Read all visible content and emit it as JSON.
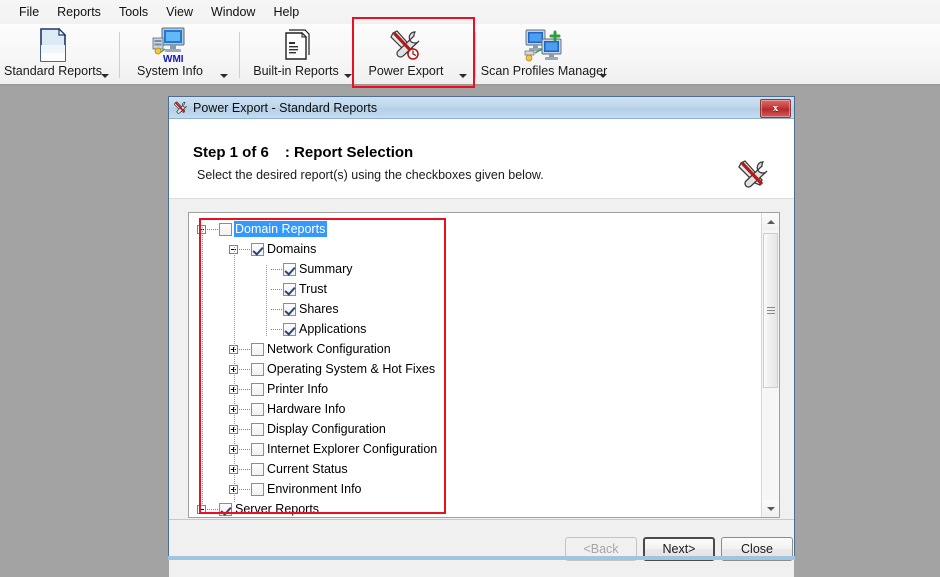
{
  "menubar": {
    "items": [
      {
        "label": "File"
      },
      {
        "label": "Reports"
      },
      {
        "label": "Tools"
      },
      {
        "label": "View"
      },
      {
        "label": "Window"
      },
      {
        "label": "Help"
      }
    ]
  },
  "toolbar": {
    "items": [
      {
        "label": "Standard Reports",
        "icon": "document-icon",
        "has_dropdown": true
      },
      {
        "label": "System Info",
        "icon": "wmi-monitor-icon",
        "has_dropdown": true
      },
      {
        "label": "Built-in Reports",
        "icon": "clipboard-icon",
        "has_dropdown": true
      },
      {
        "label": "Power Export",
        "icon": "tools-icon",
        "has_dropdown": true,
        "highlighted": true
      },
      {
        "label": "Scan Profiles Manager",
        "icon": "computers-icon",
        "has_dropdown": true
      }
    ],
    "highlight_color": "#e81123"
  },
  "dialog": {
    "title": "Power Export - Standard Reports",
    "title_icon": "tools-icon",
    "close_label": "x",
    "step_label": "Step 1 of 6",
    "step_title": ": Report Selection",
    "instruction": "Select the desired report(s) using the checkboxes given below.",
    "header_icon": "tools-icon",
    "selection_color": "#3399ff",
    "highlight_color": "#e81123",
    "tree": [
      {
        "label": "Domain Reports",
        "level": 0,
        "expander": "minus",
        "checked": false,
        "selected": true
      },
      {
        "label": "Domains",
        "level": 1,
        "expander": "minus",
        "checked": true,
        "selected": false
      },
      {
        "label": "Summary",
        "level": 2,
        "expander": "none",
        "checked": true,
        "selected": false
      },
      {
        "label": "Trust",
        "level": 2,
        "expander": "none",
        "checked": true,
        "selected": false
      },
      {
        "label": "Shares",
        "level": 2,
        "expander": "none",
        "checked": true,
        "selected": false
      },
      {
        "label": "Applications",
        "level": 2,
        "expander": "none",
        "checked": true,
        "selected": false
      },
      {
        "label": "Network Configuration",
        "level": 1,
        "expander": "plus",
        "checked": false,
        "selected": false
      },
      {
        "label": "Operating System & Hot Fixes",
        "level": 1,
        "expander": "plus",
        "checked": false,
        "selected": false
      },
      {
        "label": "Printer Info",
        "level": 1,
        "expander": "plus",
        "checked": false,
        "selected": false
      },
      {
        "label": "Hardware Info",
        "level": 1,
        "expander": "plus",
        "checked": false,
        "selected": false
      },
      {
        "label": "Display Configuration",
        "level": 1,
        "expander": "plus",
        "checked": false,
        "selected": false
      },
      {
        "label": "Internet Explorer Configuration",
        "level": 1,
        "expander": "plus",
        "checked": false,
        "selected": false
      },
      {
        "label": "Current Status",
        "level": 1,
        "expander": "plus",
        "checked": false,
        "selected": false
      },
      {
        "label": "Environment Info",
        "level": 1,
        "expander": "plus",
        "checked": false,
        "selected": false
      },
      {
        "label": "Server Reports",
        "level": 0,
        "expander": "minus",
        "checked": true,
        "selected": false
      }
    ],
    "buttons": {
      "back": "<Back",
      "next": "Next>",
      "close": "Close"
    }
  }
}
